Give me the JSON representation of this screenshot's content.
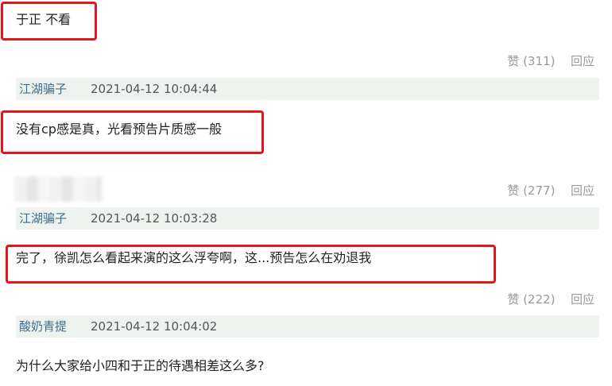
{
  "comments": [
    {
      "content": "于正 不看",
      "likes": "赞 (311)",
      "reply": "回应"
    },
    {
      "user": "江湖骗子",
      "time": "2021-04-12 10:04:44",
      "content": "没有cp感是真，光看预告片质感一般",
      "likes": "赞 (277)",
      "reply": "回应"
    },
    {
      "user": "江湖骗子",
      "time": "2021-04-12 10:03:28",
      "content": "完了，徐凯怎么看起来演的这么浮夸啊，这...预告怎么在劝退我",
      "likes": "赞 (222)",
      "reply": "回应"
    },
    {
      "user": "酸奶青提",
      "time": "2021-04-12 10:04:02",
      "content": "为什么大家给小四和于正的待遇相差这么多?"
    }
  ],
  "colors": {
    "highlight_box": "#e0171b",
    "meta_background": "#eef3f0",
    "username": "#3f6f8f",
    "action_text": "#999999"
  }
}
